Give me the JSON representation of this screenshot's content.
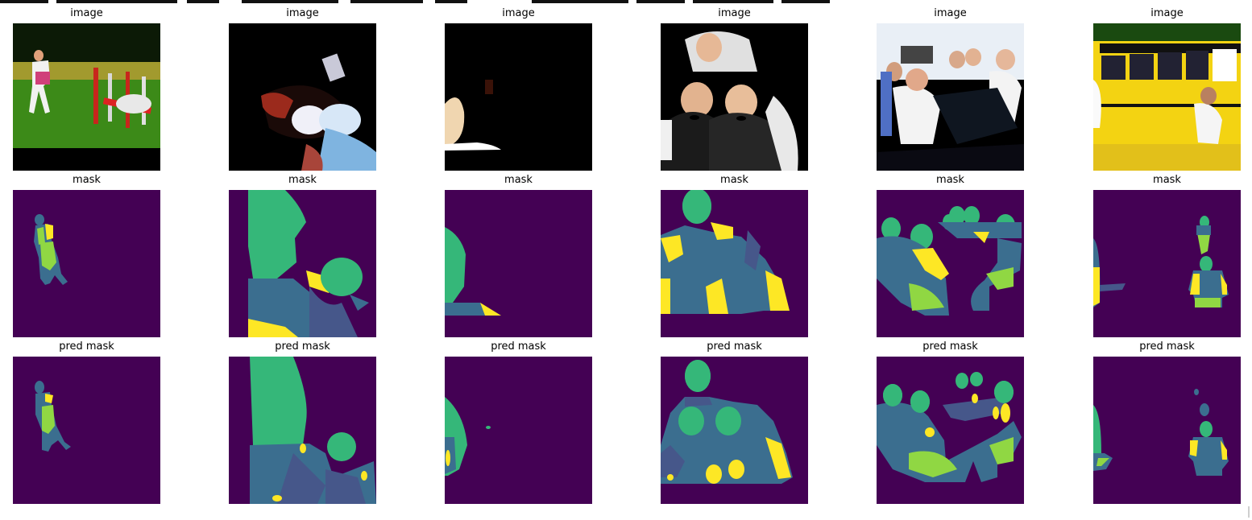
{
  "figure": {
    "columns": 6,
    "rows": [
      {
        "key": "image",
        "title": "image"
      },
      {
        "key": "mask",
        "title": "mask"
      },
      {
        "key": "pred",
        "title": "pred mask"
      }
    ]
  },
  "colors": {
    "background": "#440154",
    "class_teal": "#3b6e8f",
    "class_slate": "#46578a",
    "class_green": "#35b779",
    "class_lime": "#90d743",
    "class_yellow": "#fde725"
  }
}
